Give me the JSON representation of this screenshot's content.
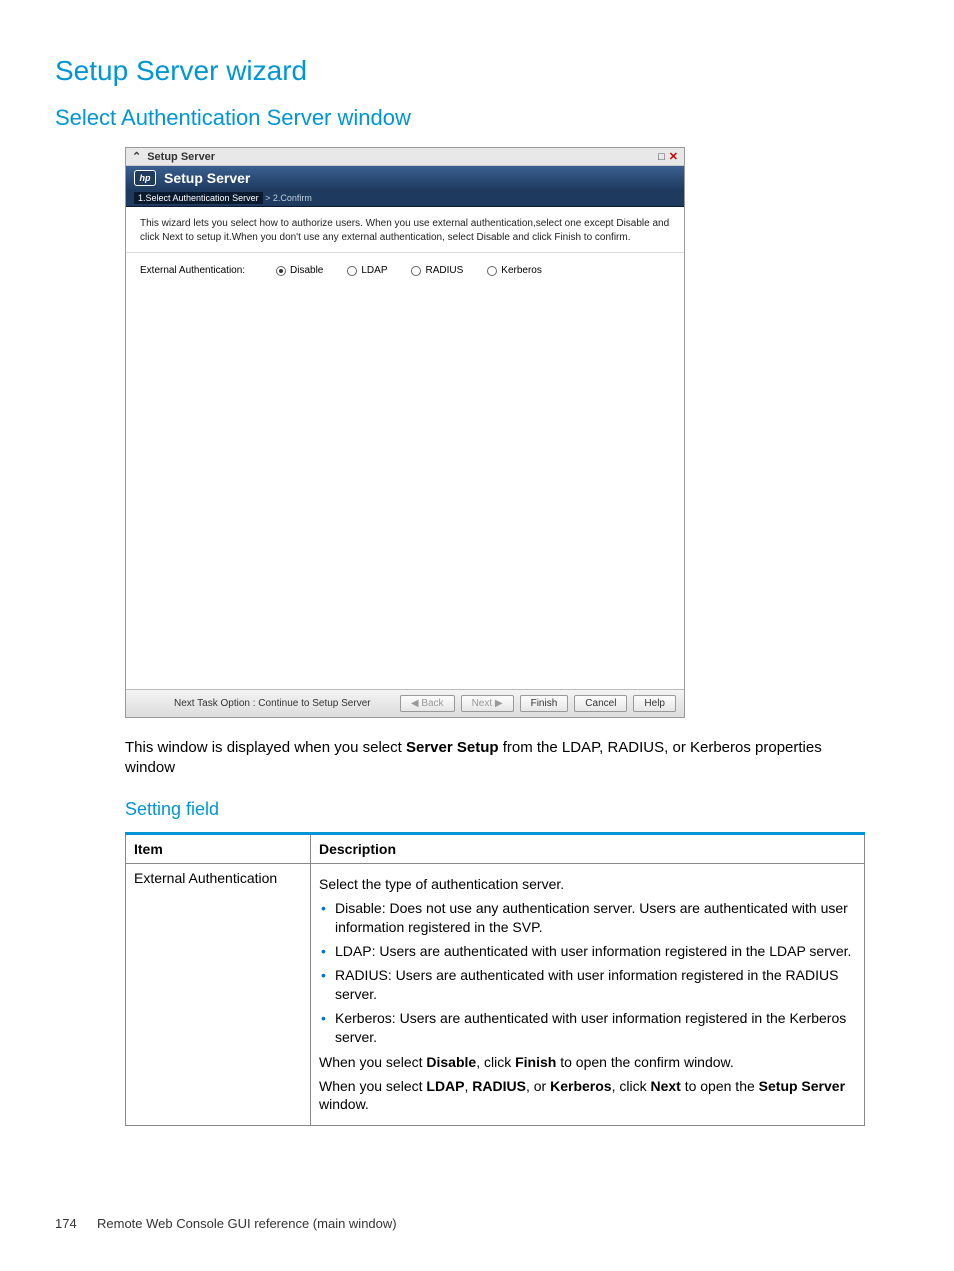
{
  "page": {
    "title": "Setup Server wizard",
    "subtitle": "Select Authentication Server window",
    "caption_pre": "This window is displayed when you select ",
    "caption_bold": "Server Setup",
    "caption_post": " from the LDAP, RADIUS, or Kerberos properties window",
    "section": "Setting field",
    "page_number": "174",
    "footer_text": "Remote Web Console GUI reference (main window)"
  },
  "screenshot": {
    "titlebar": "Setup Server",
    "header": "Setup Server",
    "logo": "hp",
    "step1": "1.Select Authentication Server",
    "step_sep": ">",
    "step2": "2.Confirm",
    "instruction": "This wizard lets you select how to authorize users. When you use external authentication,select one except Disable and click Next to setup it.When you don't use any external authentication, select Disable and click Finish to confirm.",
    "form_label": "External Authentication:",
    "radios": {
      "disable": "Disable",
      "ldap": "LDAP",
      "radius": "RADIUS",
      "kerberos": "Kerberos"
    },
    "footer_task": "Next Task Option : Continue to Setup Server",
    "buttons": {
      "back": "◀ Back",
      "next": "Next ▶",
      "finish": "Finish",
      "cancel": "Cancel",
      "help": "Help"
    }
  },
  "table": {
    "head_item": "Item",
    "head_desc": "Description",
    "row_item": "External Authentication",
    "desc_intro": "Select the type of authentication server.",
    "bullet1": "Disable: Does not use any authentication server. Users are authenticated with user information registered in the SVP.",
    "bullet2": "LDAP: Users are authenticated with user information registered in the LDAP server.",
    "bullet3": "RADIUS: Users are authenticated with user information registered in the RADIUS server.",
    "bullet4": "Kerberos: Users are authenticated with user information registered in the Kerberos server.",
    "p1_a": "When you select ",
    "p1_b1": "Disable",
    "p1_c": ", click ",
    "p1_b2": "Finish",
    "p1_d": " to open the confirm window.",
    "p2_a": "When you select ",
    "p2_b1": "LDAP",
    "p2_c": ", ",
    "p2_b2": "RADIUS",
    "p2_d": ", or ",
    "p2_b3": "Kerberos",
    "p2_e": ", click ",
    "p2_b4": "Next",
    "p2_f": " to open the ",
    "p2_b5": "Setup Server",
    "p2_g": " window."
  }
}
